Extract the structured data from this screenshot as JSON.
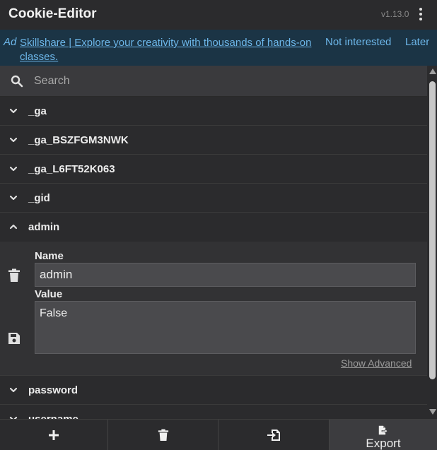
{
  "header": {
    "title": "Cookie-Editor",
    "version": "v1.13.0",
    "menu_icon": "kebab-menu-icon"
  },
  "ad": {
    "tag": "Ad",
    "link_text": "Skillshare | Explore your creativity with thousands of hands-on classes.",
    "not_interested": "Not interested",
    "later": "Later",
    "colors": {
      "background": "#1b3445",
      "text": "#6db7ea"
    }
  },
  "search": {
    "placeholder": "Search",
    "value": "",
    "icon": "search-icon"
  },
  "cookies": [
    {
      "name": "_ga",
      "expanded": false
    },
    {
      "name": "_ga_BSZFGM3NWK",
      "expanded": false
    },
    {
      "name": "_ga_L6FT52K063",
      "expanded": false
    },
    {
      "name": "_gid",
      "expanded": false
    },
    {
      "name": "admin",
      "expanded": true
    },
    {
      "name": "password",
      "expanded": false
    },
    {
      "name": "username",
      "expanded": false
    }
  ],
  "detail": {
    "name_label": "Name",
    "name_value": "admin",
    "value_label": "Value",
    "value_value": "False",
    "show_advanced": "Show Advanced",
    "delete_icon": "trash-icon",
    "save_icon": "save-icon"
  },
  "footer": {
    "add_icon": "plus-icon",
    "delete_all_icon": "trash-icon",
    "import_icon": "import-icon",
    "export_icon": "export-file-icon",
    "export_label": "Export"
  }
}
